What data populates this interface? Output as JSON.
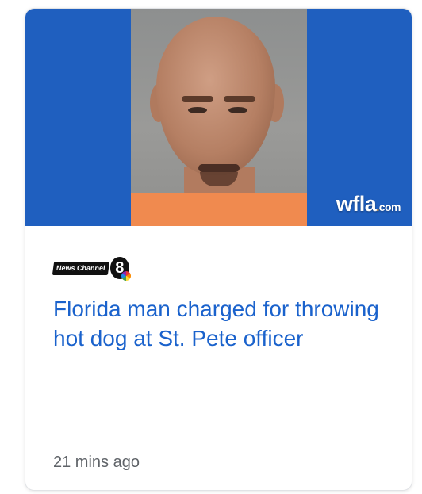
{
  "article": {
    "watermark": {
      "brand": "wfla",
      "dot": ".",
      "tld": "com"
    },
    "source": {
      "logo_text": "News Channel",
      "logo_number": "8"
    },
    "headline": "Florida man charged for throwing hot dog at St. Pete officer",
    "timestamp": "21 mins ago"
  }
}
